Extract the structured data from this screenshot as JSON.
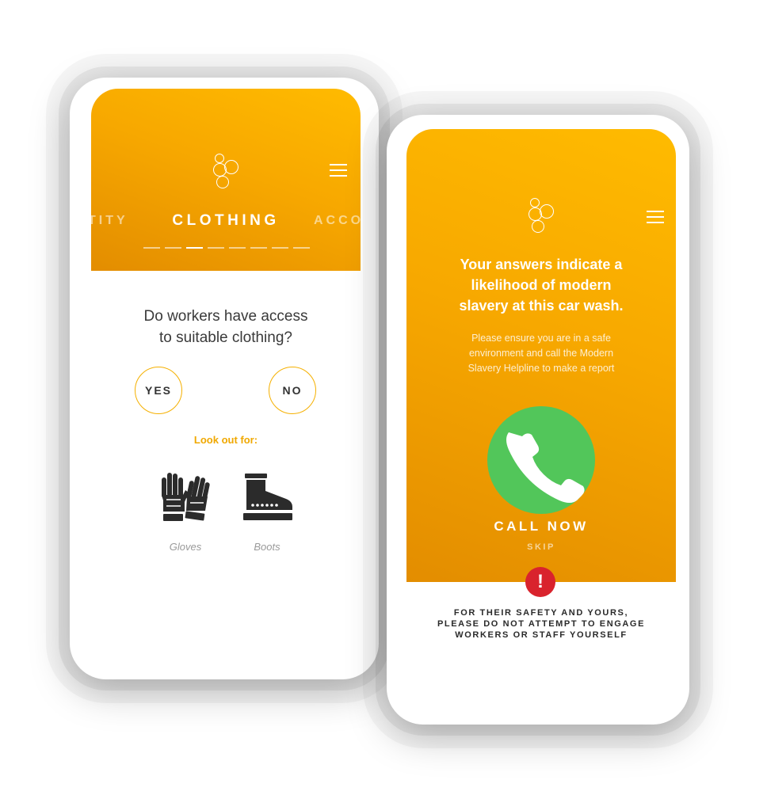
{
  "left_screen": {
    "categories": {
      "prev": "TITY",
      "current": "CLOTHING",
      "next": "ACCO"
    },
    "progress": {
      "total_steps": 8,
      "active_step": 3
    },
    "question": [
      "Do workers have access",
      "to suitable clothing?"
    ],
    "yes_label": "YES",
    "no_label": "NO",
    "lookout_label": "Look out for:",
    "items": [
      {
        "label": "Gloves",
        "icon": "gloves-icon"
      },
      {
        "label": "Boots",
        "icon": "boots-icon"
      }
    ]
  },
  "right_screen": {
    "headline": [
      "Your answers indicate a",
      "likelihood of modern",
      "slavery at this car wash."
    ],
    "subtext": [
      "Please ensure you are in a safe",
      "environment and call the Modern",
      "Slavery Helpline to make a report"
    ],
    "call_label": "CALL NOW",
    "skip_label": "SKIP",
    "alert_symbol": "!",
    "warning": [
      "FOR THEIR SAFETY AND YOURS,",
      "PLEASE DO NOT ATTEMPT TO ENGAGE",
      "WORKERS OR STAFF YOURSELF"
    ]
  },
  "colors": {
    "brand_orange": "#f7a800",
    "accent_yellow": "#f5b000",
    "call_green": "#52c65a",
    "alert_red": "#d9232d"
  }
}
